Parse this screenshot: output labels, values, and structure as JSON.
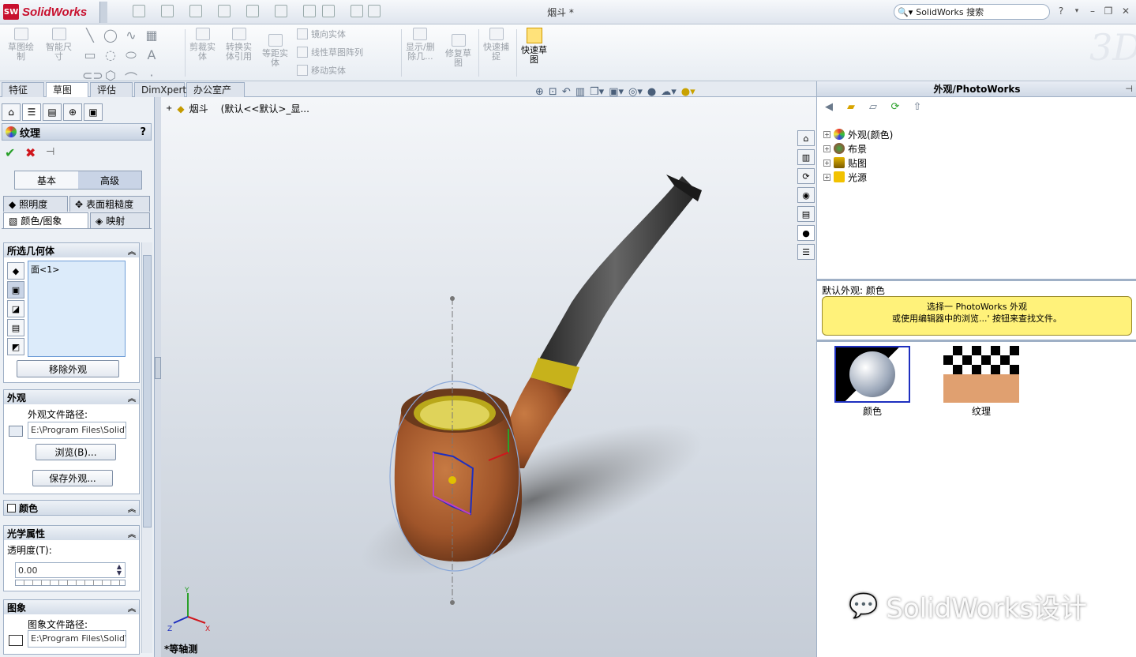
{
  "app": {
    "name": "SolidWorks",
    "badge": "SW",
    "doc_title": "烟斗 *"
  },
  "search": {
    "placeholder": "SolidWorks 搜索"
  },
  "window": {
    "help": "?",
    "minimize": "–",
    "restore": "❐",
    "close": "✕"
  },
  "ribbon": {
    "sketch": "草图绘\n制",
    "smart_dim": "智能尺\n寸",
    "trim": "剪裁实\n体",
    "convert": "转换实\n体引用",
    "offset": "等距实\n体",
    "mirror": "镜向实体",
    "linear_pattern": "线性草图阵列",
    "move": "移动实体",
    "show_delete": "显示/删\n除几...",
    "repair": "修复草\n图",
    "snap": "快速捕\n捉",
    "quick_sketch": "快速草\n图"
  },
  "tabs": [
    "特征",
    "草图",
    "评估",
    "DimXpert",
    "办公室产品"
  ],
  "active_tab": "草图",
  "property_manager": {
    "title": "纹理",
    "help": "?",
    "mode_basic": "基本",
    "mode_advanced": "高级",
    "tabs_row1": [
      "照明度",
      "表面粗糙度"
    ],
    "tabs_row2": [
      "颜色/图象",
      "映射"
    ],
    "selected_geometry": {
      "header": "所选几何体",
      "item": "面<1>",
      "remove_button": "移除外观"
    },
    "appearance": {
      "header": "外观",
      "path_label": "外观文件路径:",
      "path_value": "E:\\Program Files\\SolidWo",
      "browse_button": "浏览(B)...",
      "save_button": "保存外观..."
    },
    "color": {
      "header": "颜色"
    },
    "optical": {
      "header": "光学属性",
      "transparency_label": "透明度(T):",
      "transparency_value": "0.00"
    },
    "image": {
      "header": "图象",
      "path_label": "图象文件路径:",
      "path_value": "E:\\Program Files\\SolidWo"
    }
  },
  "viewport": {
    "tree_node": "烟斗",
    "config_text": "(默认<<默认>_显...",
    "view_label": "*等轴测",
    "triad": {
      "x": "X",
      "y": "Y",
      "z": "Z"
    }
  },
  "task_pane": {
    "title": "外观/PhotoWorks",
    "tree": [
      "外观(颜色)",
      "布景",
      "贴图",
      "光源"
    ],
    "default_label": "默认外观: 颜色",
    "hint_line1": "选择一 PhotoWorks 外观",
    "hint_line2": "或使用编辑器中的浏览...' 按钮来查找文件。",
    "thumbnails": [
      "颜色",
      "纹理"
    ]
  },
  "watermark": "SolidWorks设计",
  "colors": {
    "accent_red": "#c8102e",
    "hint_yellow": "#fff27a",
    "selection_blue": "#1e2fbf"
  }
}
